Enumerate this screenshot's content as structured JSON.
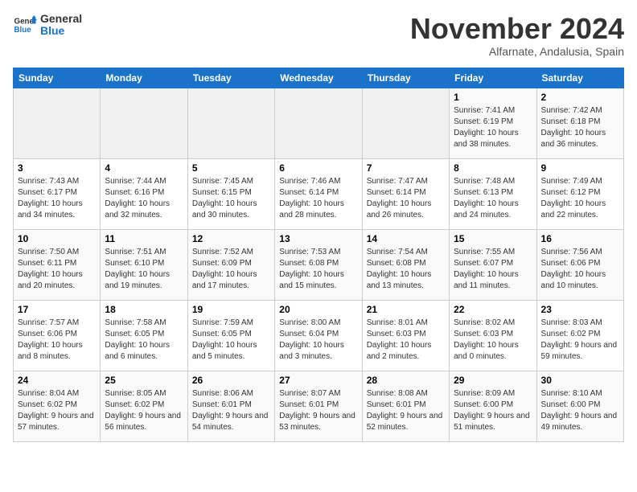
{
  "logo": {
    "line1": "General",
    "line2": "Blue"
  },
  "title": "November 2024",
  "subtitle": "Alfarnate, Andalusia, Spain",
  "weekdays": [
    "Sunday",
    "Monday",
    "Tuesday",
    "Wednesday",
    "Thursday",
    "Friday",
    "Saturday"
  ],
  "weeks": [
    [
      {
        "day": "",
        "info": ""
      },
      {
        "day": "",
        "info": ""
      },
      {
        "day": "",
        "info": ""
      },
      {
        "day": "",
        "info": ""
      },
      {
        "day": "",
        "info": ""
      },
      {
        "day": "1",
        "info": "Sunrise: 7:41 AM\nSunset: 6:19 PM\nDaylight: 10 hours and 38 minutes."
      },
      {
        "day": "2",
        "info": "Sunrise: 7:42 AM\nSunset: 6:18 PM\nDaylight: 10 hours and 36 minutes."
      }
    ],
    [
      {
        "day": "3",
        "info": "Sunrise: 7:43 AM\nSunset: 6:17 PM\nDaylight: 10 hours and 34 minutes."
      },
      {
        "day": "4",
        "info": "Sunrise: 7:44 AM\nSunset: 6:16 PM\nDaylight: 10 hours and 32 minutes."
      },
      {
        "day": "5",
        "info": "Sunrise: 7:45 AM\nSunset: 6:15 PM\nDaylight: 10 hours and 30 minutes."
      },
      {
        "day": "6",
        "info": "Sunrise: 7:46 AM\nSunset: 6:14 PM\nDaylight: 10 hours and 28 minutes."
      },
      {
        "day": "7",
        "info": "Sunrise: 7:47 AM\nSunset: 6:14 PM\nDaylight: 10 hours and 26 minutes."
      },
      {
        "day": "8",
        "info": "Sunrise: 7:48 AM\nSunset: 6:13 PM\nDaylight: 10 hours and 24 minutes."
      },
      {
        "day": "9",
        "info": "Sunrise: 7:49 AM\nSunset: 6:12 PM\nDaylight: 10 hours and 22 minutes."
      }
    ],
    [
      {
        "day": "10",
        "info": "Sunrise: 7:50 AM\nSunset: 6:11 PM\nDaylight: 10 hours and 20 minutes."
      },
      {
        "day": "11",
        "info": "Sunrise: 7:51 AM\nSunset: 6:10 PM\nDaylight: 10 hours and 19 minutes."
      },
      {
        "day": "12",
        "info": "Sunrise: 7:52 AM\nSunset: 6:09 PM\nDaylight: 10 hours and 17 minutes."
      },
      {
        "day": "13",
        "info": "Sunrise: 7:53 AM\nSunset: 6:08 PM\nDaylight: 10 hours and 15 minutes."
      },
      {
        "day": "14",
        "info": "Sunrise: 7:54 AM\nSunset: 6:08 PM\nDaylight: 10 hours and 13 minutes."
      },
      {
        "day": "15",
        "info": "Sunrise: 7:55 AM\nSunset: 6:07 PM\nDaylight: 10 hours and 11 minutes."
      },
      {
        "day": "16",
        "info": "Sunrise: 7:56 AM\nSunset: 6:06 PM\nDaylight: 10 hours and 10 minutes."
      }
    ],
    [
      {
        "day": "17",
        "info": "Sunrise: 7:57 AM\nSunset: 6:06 PM\nDaylight: 10 hours and 8 minutes."
      },
      {
        "day": "18",
        "info": "Sunrise: 7:58 AM\nSunset: 6:05 PM\nDaylight: 10 hours and 6 minutes."
      },
      {
        "day": "19",
        "info": "Sunrise: 7:59 AM\nSunset: 6:05 PM\nDaylight: 10 hours and 5 minutes."
      },
      {
        "day": "20",
        "info": "Sunrise: 8:00 AM\nSunset: 6:04 PM\nDaylight: 10 hours and 3 minutes."
      },
      {
        "day": "21",
        "info": "Sunrise: 8:01 AM\nSunset: 6:03 PM\nDaylight: 10 hours and 2 minutes."
      },
      {
        "day": "22",
        "info": "Sunrise: 8:02 AM\nSunset: 6:03 PM\nDaylight: 10 hours and 0 minutes."
      },
      {
        "day": "23",
        "info": "Sunrise: 8:03 AM\nSunset: 6:02 PM\nDaylight: 9 hours and 59 minutes."
      }
    ],
    [
      {
        "day": "24",
        "info": "Sunrise: 8:04 AM\nSunset: 6:02 PM\nDaylight: 9 hours and 57 minutes."
      },
      {
        "day": "25",
        "info": "Sunrise: 8:05 AM\nSunset: 6:02 PM\nDaylight: 9 hours and 56 minutes."
      },
      {
        "day": "26",
        "info": "Sunrise: 8:06 AM\nSunset: 6:01 PM\nDaylight: 9 hours and 54 minutes."
      },
      {
        "day": "27",
        "info": "Sunrise: 8:07 AM\nSunset: 6:01 PM\nDaylight: 9 hours and 53 minutes."
      },
      {
        "day": "28",
        "info": "Sunrise: 8:08 AM\nSunset: 6:01 PM\nDaylight: 9 hours and 52 minutes."
      },
      {
        "day": "29",
        "info": "Sunrise: 8:09 AM\nSunset: 6:00 PM\nDaylight: 9 hours and 51 minutes."
      },
      {
        "day": "30",
        "info": "Sunrise: 8:10 AM\nSunset: 6:00 PM\nDaylight: 9 hours and 49 minutes."
      }
    ]
  ]
}
